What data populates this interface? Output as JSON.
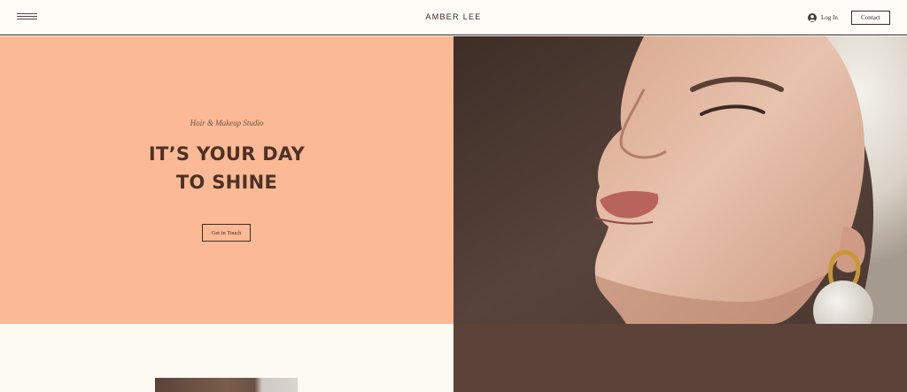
{
  "header": {
    "menu_icon": "hamburger-menu-icon",
    "brand": "AMBER LEE",
    "login_icon": "user-avatar-icon",
    "login_label": "Log In",
    "contact_label": "Contact"
  },
  "hero": {
    "tagline": "Hair & Makeup Studio",
    "headline_line1": "IT’S YOUR DAY",
    "headline_line2": "TO SHINE",
    "cta_label": "Get in Touch",
    "image": "portrait-photo"
  },
  "colors": {
    "accent_peach": "#fbb995",
    "dark_brown": "#5b4339",
    "cream": "#fdf9f3",
    "text": "#3a2a22"
  }
}
